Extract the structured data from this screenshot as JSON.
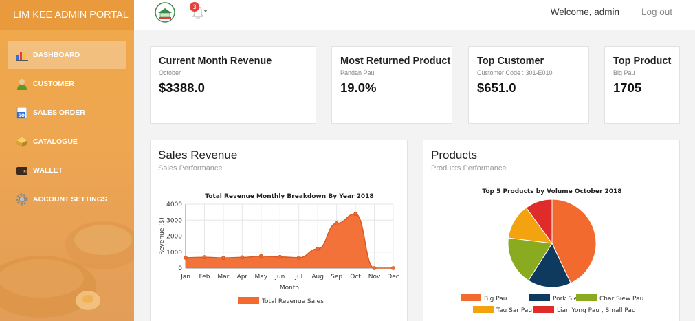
{
  "app": {
    "brand": "LIM KEE ADMIN PORTAL"
  },
  "topbar": {
    "notification_count": "3",
    "welcome": "Welcome, admin",
    "logout": "Log out"
  },
  "sidebar": {
    "items": [
      {
        "label": "DASHBOARD",
        "icon": "bar-chart-icon",
        "active": true
      },
      {
        "label": "CUSTOMER",
        "icon": "user-icon",
        "active": false
      },
      {
        "label": "SALES ORDER",
        "icon": "sales-order-icon",
        "active": false
      },
      {
        "label": "CATALOGUE",
        "icon": "box-icon",
        "active": false
      },
      {
        "label": "WALLET",
        "icon": "wallet-icon",
        "active": false
      },
      {
        "label": "ACCOUNT SETTINGS",
        "icon": "gear-icon",
        "active": false
      }
    ]
  },
  "stats": [
    {
      "title": "Current Month Revenue",
      "sub": "October",
      "value": "$3388.0"
    },
    {
      "title": "Most Returned Product",
      "sub": "Pandan Pau",
      "value": "19.0%"
    },
    {
      "title": "Top Customer",
      "sub": "Customer Code : 301-E010",
      "value": "$651.0"
    },
    {
      "title": "Top Product",
      "sub": "Big Pau",
      "value": "1705"
    }
  ],
  "sales_panel": {
    "title": "Sales Revenue",
    "subtitle": "Sales Performance"
  },
  "products_panel": {
    "title": "Products",
    "subtitle": "Products Performance"
  },
  "colors": {
    "orange": "#f26a2e",
    "navy": "#0f3a5f",
    "green": "#8aab1f",
    "yellow": "#f2a30f",
    "red": "#e02b2b"
  },
  "chart_data": [
    {
      "type": "area",
      "title": "Total Revenue Monthly Breakdown By Year 2018",
      "xlabel": "Month",
      "ylabel": "Revenue ($)",
      "categories": [
        "Jan",
        "Feb",
        "Mar",
        "Apr",
        "May",
        "Jun",
        "Jul",
        "Aug",
        "Sep",
        "Oct",
        "Nov",
        "Dec"
      ],
      "ylim": [
        0,
        4000
      ],
      "yticks": [
        0,
        1000,
        2000,
        3000,
        4000
      ],
      "grid": true,
      "legend": "bottom",
      "series": [
        {
          "name": "Total Revenue Sales",
          "color": "#f26a2e",
          "values": [
            650,
            680,
            640,
            670,
            750,
            700,
            650,
            1200,
            2800,
            3388,
            0,
            0
          ]
        }
      ]
    },
    {
      "type": "pie",
      "title": "Top 5 Products by Volume October 2018",
      "legend": "bottom",
      "labels": [
        "Big Pau",
        "Pork Siew Mai",
        "Char Siew Pau",
        "Tau Sar Pau",
        "Lian Yong Pau , Small Pau"
      ],
      "values": [
        43,
        16,
        18,
        13,
        10
      ],
      "colors": [
        "#f26a2e",
        "#0f3a5f",
        "#8aab1f",
        "#f2a30f",
        "#e02b2b"
      ]
    }
  ]
}
